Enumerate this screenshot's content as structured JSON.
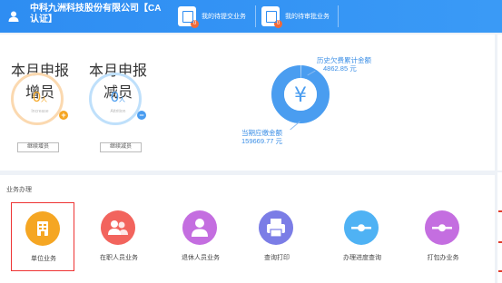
{
  "header": {
    "company": "中科九洲科技股份有限公司【CA认证】",
    "todo_label": "我的待提交业务",
    "todo_count": "0",
    "pending_label": "我的待审批业务",
    "pending_count": "0"
  },
  "summary": {
    "monthly_add": {
      "title": "本月申报增员",
      "value": "0",
      "unit": "人",
      "sub": "Increase",
      "button": "继续增员"
    },
    "monthly_reduce": {
      "title": "本月申报减员",
      "value": "0",
      "unit": "人",
      "sub": "Attrition",
      "button": "继续减员"
    },
    "arrears": {
      "label": "历史欠费累计金额",
      "value": "4862.85 元"
    },
    "current_due": {
      "label": "当期应缴金额",
      "value": "159669.77 元"
    },
    "pie_symbol": "¥"
  },
  "business": {
    "title": "业务办理",
    "items": [
      {
        "label": "单位业务",
        "icon": "building-icon",
        "color": "#f5a623"
      },
      {
        "label": "在职人员业务",
        "icon": "people-icon",
        "color": "#f2645d"
      },
      {
        "label": "退休人员业务",
        "icon": "person-icon",
        "color": "#c46ee0"
      },
      {
        "label": "查询打印",
        "icon": "printer-icon",
        "color": "#7b7de6"
      },
      {
        "label": "办理进度查询",
        "icon": "progress-icon",
        "color": "#4fb2f4"
      },
      {
        "label": "打包办业务",
        "icon": "package-icon",
        "color": "#c46ee0"
      }
    ]
  },
  "colors": {
    "header": "#2e8df2",
    "orange": "#f5a623",
    "blue": "#4a9df0",
    "selected_border": "#e33333"
  }
}
